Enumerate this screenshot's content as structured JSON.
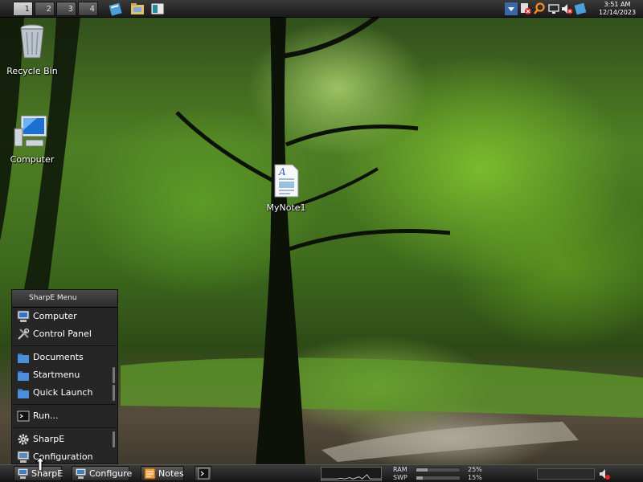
{
  "top_panel": {
    "workspaces": [
      {
        "label": "1",
        "active": true
      },
      {
        "label": "2",
        "active": false
      },
      {
        "label": "3",
        "active": false
      },
      {
        "label": "4",
        "active": false
      }
    ],
    "quick_launch": [
      "notes-icon",
      "file-manager-icon",
      "screen-icon"
    ],
    "tray_icons": [
      "arrow-down-icon",
      "network-disabled-icon",
      "search-icon",
      "display-icon",
      "volume-muted-icon",
      "notes-tray-icon"
    ],
    "clock": {
      "time": "3:51 AM",
      "date": "12/14/2023"
    }
  },
  "desktop": {
    "icons": [
      {
        "label": "Recycle Bin",
        "icon": "recycle-bin-icon"
      },
      {
        "label": "Computer",
        "icon": "computer-icon"
      },
      {
        "label": "MyNote1",
        "icon": "document-icon"
      }
    ]
  },
  "start_menu": {
    "title": "SharpE Menu",
    "groups": [
      [
        {
          "label": "Computer",
          "icon": "computer-icon"
        },
        {
          "label": "Control Panel",
          "icon": "tools-icon"
        }
      ],
      [
        {
          "label": "Documents",
          "icon": "folder-icon"
        },
        {
          "label": "Startmenu",
          "icon": "folder-icon"
        },
        {
          "label": "Quick Launch",
          "icon": "folder-icon"
        }
      ],
      [
        {
          "label": "Run...",
          "icon": "run-icon"
        }
      ],
      [
        {
          "label": "SharpE",
          "icon": "gear-icon"
        },
        {
          "label": "Configuration",
          "icon": "configuration-icon"
        }
      ]
    ]
  },
  "taskbar": {
    "buttons": [
      {
        "label": "SharpE",
        "icon": "sharpe-icon"
      },
      {
        "label": "Configure",
        "icon": "configure-icon"
      },
      {
        "label": "Notes",
        "icon": "notes-icon"
      },
      {
        "label": "",
        "icon": "terminal-icon"
      }
    ],
    "memory": [
      {
        "label": "RAM",
        "percent": "25%",
        "fraction": 0.25
      },
      {
        "label": "SWP",
        "percent": "15%",
        "fraction": 0.15
      }
    ]
  },
  "colors": {
    "panel": "#262626",
    "folder": "#3a80d0",
    "accent_blue": "#4d8fd6"
  }
}
